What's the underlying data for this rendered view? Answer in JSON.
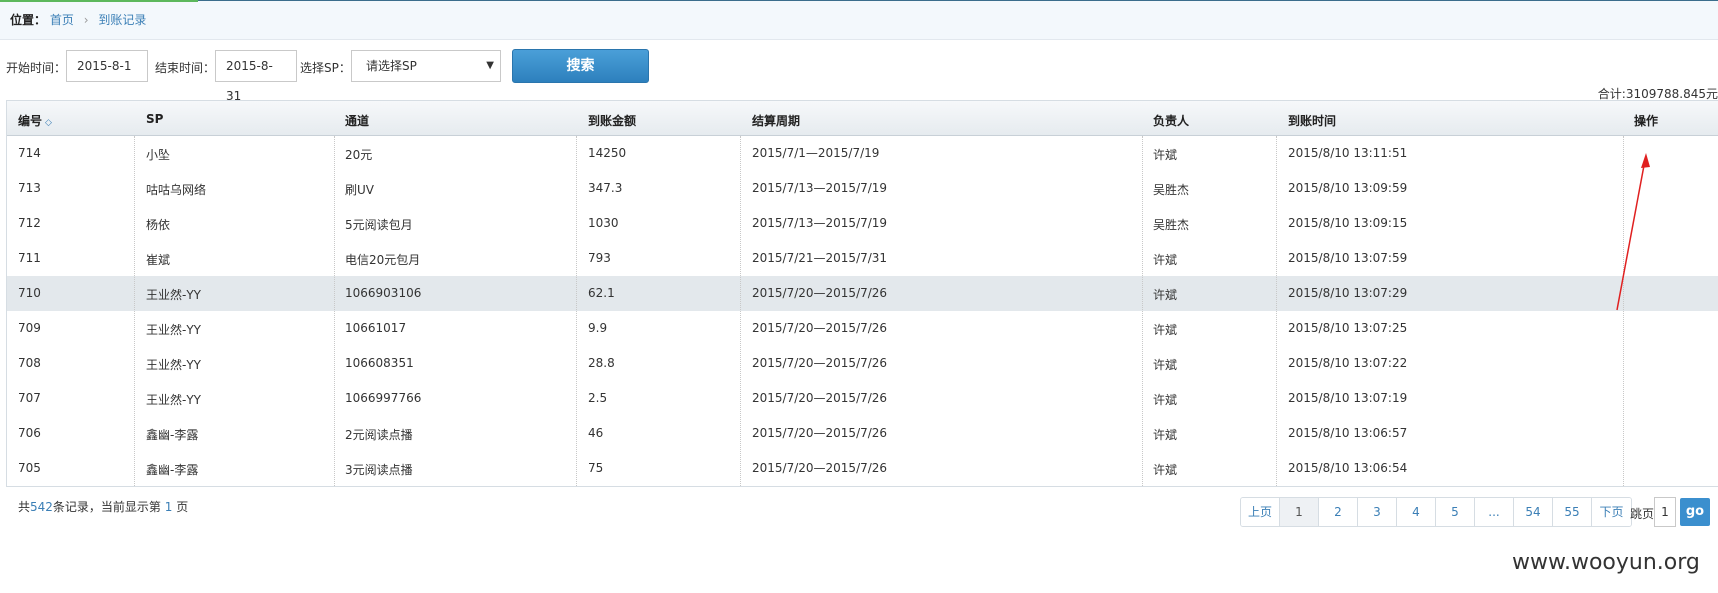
{
  "breadcrumb": {
    "label": "位置：",
    "home": "首页",
    "separator": "›",
    "current": "到账记录"
  },
  "filters": {
    "start_label": "开始时间：",
    "start_value": "2015-8-1",
    "end_label": "结束时间：",
    "end_value": "2015-8-31",
    "sp_label": "选择SP：",
    "sp_value": "请选择SP",
    "sp_arrow": "▼",
    "search_label": "搜索"
  },
  "total": "合计:3109788.845元",
  "table": {
    "headers": [
      "编号",
      "SP",
      "通道",
      "到账金额",
      "结算周期",
      "负责人",
      "到账时间",
      "操作"
    ],
    "sort_glyph": "◇",
    "rows": [
      [
        "714",
        "小坠",
        "20元",
        "14250",
        "2015/7/1—2015/7/19",
        "许斌",
        "2015/8/10 13:11:51"
      ],
      [
        "713",
        "咕咕乌网络",
        "刷UV",
        "347.3",
        "2015/7/13—2015/7/19",
        "吴胜杰",
        "2015/8/10 13:09:59"
      ],
      [
        "712",
        "杨依",
        "5元阅读包月",
        "1030",
        "2015/7/13—2015/7/19",
        "吴胜杰",
        "2015/8/10 13:09:15"
      ],
      [
        "711",
        "崔斌",
        "电信20元包月",
        "793",
        "2015/7/21—2015/7/31",
        "许斌",
        "2015/8/10 13:07:59"
      ],
      [
        "710",
        "王业然-YY",
        "1066903106",
        "62.1",
        "2015/7/20—2015/7/26",
        "许斌",
        "2015/8/10 13:07:29"
      ],
      [
        "709",
        "王业然-YY",
        "10661017",
        "9.9",
        "2015/7/20—2015/7/26",
        "许斌",
        "2015/8/10 13:07:25"
      ],
      [
        "708",
        "王业然-YY",
        "106608351",
        "28.8",
        "2015/7/20—2015/7/26",
        "许斌",
        "2015/8/10 13:07:22"
      ],
      [
        "707",
        "王业然-YY",
        "1066997766",
        "2.5",
        "2015/7/20—2015/7/26",
        "许斌",
        "2015/8/10 13:07:19"
      ],
      [
        "706",
        "鑫幽-李露",
        "2元阅读点播",
        "46",
        "2015/7/20—2015/7/26",
        "许斌",
        "2015/8/10 13:06:57"
      ],
      [
        "705",
        "鑫幽-李露",
        "3元阅读点播",
        "75",
        "2015/7/20—2015/7/26",
        "许斌",
        "2015/8/10 13:06:54"
      ]
    ]
  },
  "footer": {
    "prefix": "共",
    "count": "542",
    "middle": "条记录，当前显示第 ",
    "page": "1",
    "suffix": " 页"
  },
  "pager": {
    "prev": "上页",
    "pages": [
      "1",
      "2",
      "3",
      "4",
      "5",
      "...",
      "54",
      "55"
    ],
    "next": "下页",
    "jump_label": "跳页",
    "jump_value": "1",
    "go": "go"
  },
  "watermark": "www.wooyun.org",
  "colors": {
    "link": "#3b7fb6",
    "button": "#2d80bd",
    "annotation": "#e02020"
  }
}
